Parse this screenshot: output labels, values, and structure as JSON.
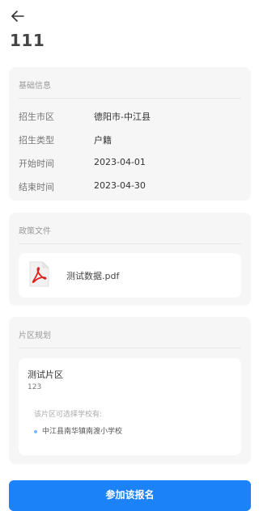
{
  "header": {
    "title": "111"
  },
  "basic_info": {
    "title": "基础信息",
    "rows": [
      {
        "label": "招生市区",
        "value": "德阳市-中江县"
      },
      {
        "label": "招生类型",
        "value": "户籍"
      },
      {
        "label": "开始时间",
        "value": "2023-04-01"
      },
      {
        "label": "结束时间",
        "value": "2023-04-30"
      }
    ]
  },
  "policy_files": {
    "title": "政策文件",
    "files": [
      {
        "name": "测试数据.pdf",
        "icon": "pdf-icon"
      }
    ]
  },
  "district_plan": {
    "title": "片区规划",
    "area": {
      "name": "测试片区",
      "code": "123",
      "schools_label": "该片区可选择学校有:",
      "schools": [
        "中江县南华镇南渡小学校"
      ]
    }
  },
  "actions": {
    "join_label": "参加该报名"
  },
  "colors": {
    "primary": "#1b82f7",
    "card_bg": "#f6f6f7",
    "pdf_red": "#d8231b"
  }
}
